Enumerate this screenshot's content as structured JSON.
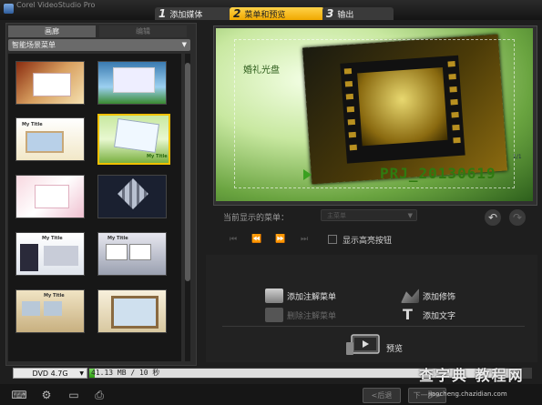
{
  "window": {
    "title": "Corel VideoStudio Pro"
  },
  "steps": [
    {
      "num": "1",
      "label": "添加媒体"
    },
    {
      "num": "2",
      "label": "菜单和预览"
    },
    {
      "num": "3",
      "label": "输出"
    }
  ],
  "left_panel": {
    "tabs": [
      "画廊",
      "编辑"
    ],
    "dropdown": "智能场景菜单",
    "thumbnail_titles": [
      "My Title",
      "My Title",
      "My Title",
      "My Title",
      "My Title"
    ]
  },
  "preview": {
    "menu_caption": "婚礼光盘",
    "project_name": "PRJ_20130619",
    "page_indicator": "1/1"
  },
  "controls": {
    "current_menu_label": "当前显示的菜单：",
    "current_menu_value": "主菜单",
    "highlight_checkbox_label": "显示高亮按钮"
  },
  "actions": {
    "add_note_menu": "添加注解菜单",
    "delete_note_menu": "删除注解菜单",
    "add_decoration": "添加修饰",
    "add_text": "添加文字",
    "preview": "预览"
  },
  "status": {
    "disc_type": "DVD 4.7G",
    "size_text": "41.13 MB / 10 秒",
    "used_fraction": 0.012
  },
  "nav": {
    "back": "<后退",
    "next": "下一步>"
  },
  "watermark": {
    "line1": "查字典 教程网",
    "line2": "jiaocheng.chazidian.com"
  }
}
